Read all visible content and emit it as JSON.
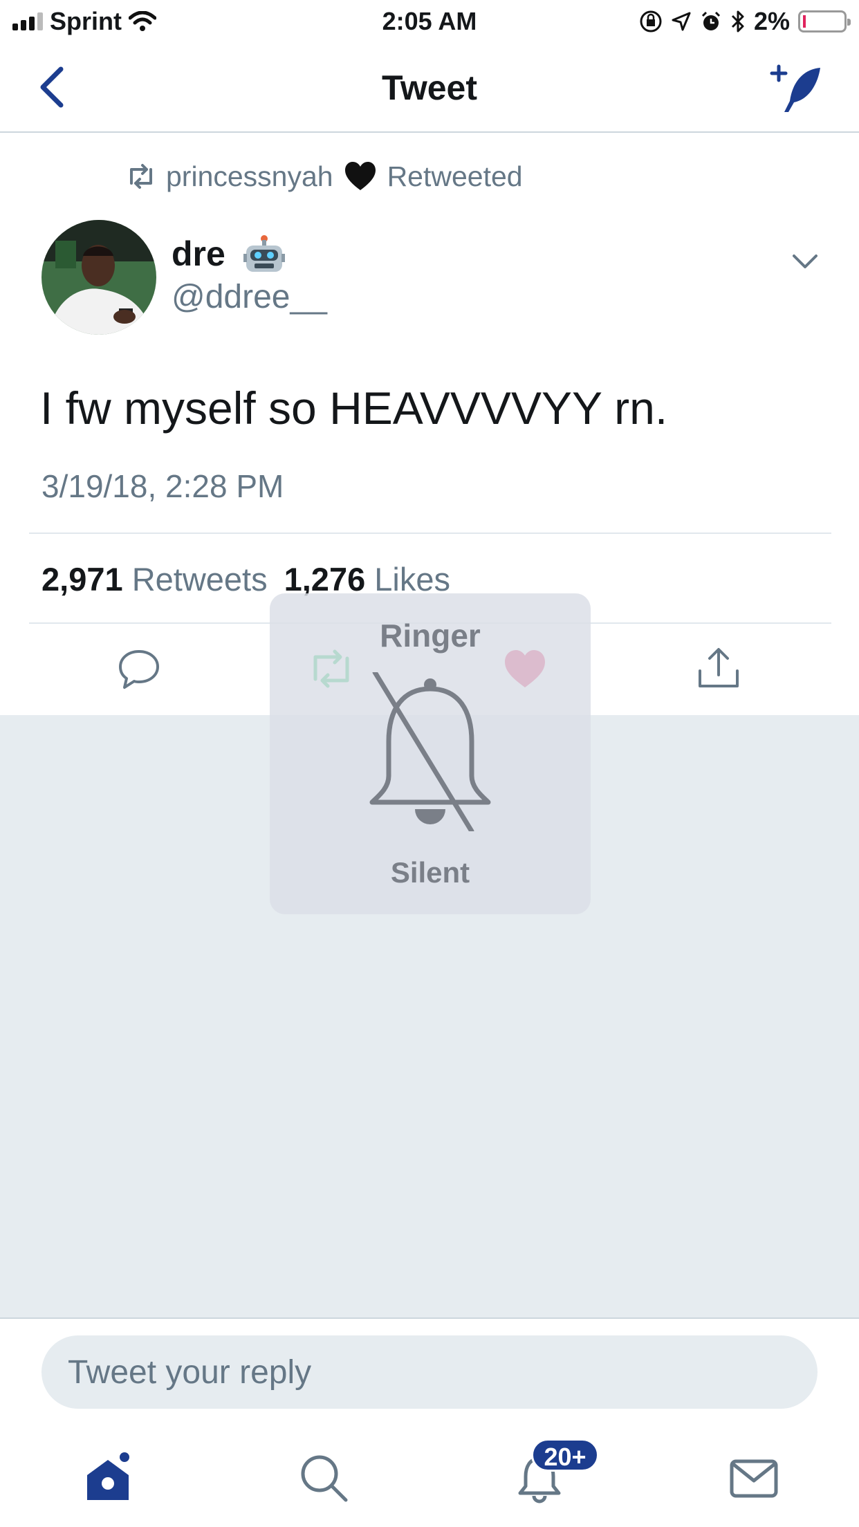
{
  "status_bar": {
    "carrier": "Sprint",
    "time": "2:05 AM",
    "battery_percent": "2%"
  },
  "nav": {
    "title": "Tweet"
  },
  "tweet": {
    "retweeted_by": "princessnyah",
    "retweeted_label": "Retweeted",
    "author_name": "dre",
    "author_handle": "@ddree__",
    "text": "I fw myself so HEAVVVVYY rn.",
    "timestamp": "3/19/18, 2:28 PM",
    "retweet_count": "2,971",
    "retweet_label": "Retweets",
    "like_count": "1,276",
    "like_label": "Likes"
  },
  "hud": {
    "title": "Ringer",
    "label": "Silent"
  },
  "reply": {
    "placeholder": "Tweet your reply"
  },
  "tabbar": {
    "notifications_badge": "20+"
  },
  "colors": {
    "accent": "#1c3d8f",
    "secondary_text": "#657786",
    "background": "#e6ecf0"
  }
}
